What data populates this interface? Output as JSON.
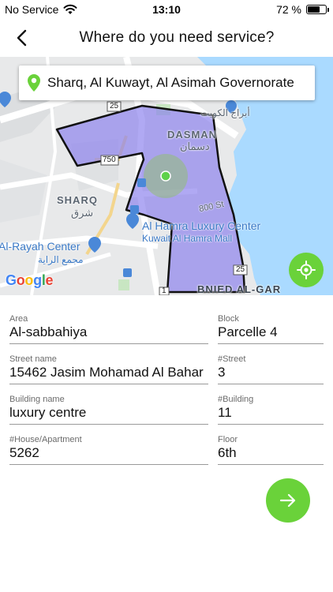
{
  "status_bar": {
    "carrier": "No Service",
    "time": "13:10",
    "battery_text": "72 %",
    "battery_level": 0.72
  },
  "header": {
    "back_icon": "chevron-left-icon",
    "title": "Where do you need service?"
  },
  "map": {
    "search_value": "Sharq, Al Kuwayt, Al Asimah Governorate",
    "pin_icon": "location-pin-icon",
    "locate_icon": "my-location-icon",
    "google_logo": "Google",
    "labels": {
      "dasman": "DASMAN",
      "dasman_ar": "دسمان",
      "sharq": "SHARQ",
      "sharq_ar": "شرق",
      "towers_ar": "أبراج الكويت",
      "hamra_center": "Al Hamra Luxury Center",
      "hamra_mall": "Kuwait Al Hamra Mall",
      "rayah_center": "Al-Rayah Center",
      "rayah_ar": "مجمع الراية",
      "bnied": "BNIED AL-GAR",
      "road_800": "800 St",
      "road_25_a": "25",
      "road_25_b": "25",
      "road_750": "750",
      "road_1": "1"
    },
    "colors": {
      "zone_fill": "#8a80ee",
      "water": "#aadaff",
      "accent": "#6ad23a"
    }
  },
  "form": {
    "area": {
      "label": "Area",
      "value": "Al-sabbahiya"
    },
    "block": {
      "label": "Block",
      "value": "Parcelle 4"
    },
    "street_name": {
      "label": "Street name",
      "value": "15462 Jasim Mohamad Al Bahar"
    },
    "street_no": {
      "label": "#Street",
      "value": "3"
    },
    "building_name": {
      "label": "Building name",
      "value": "luxury centre"
    },
    "building_no": {
      "label": "#Building",
      "value": "11"
    },
    "house": {
      "label": "#House/Apartment",
      "value": "5262"
    },
    "floor": {
      "label": "Floor",
      "value": "6th"
    }
  },
  "next_button": {
    "icon": "arrow-right-icon"
  }
}
